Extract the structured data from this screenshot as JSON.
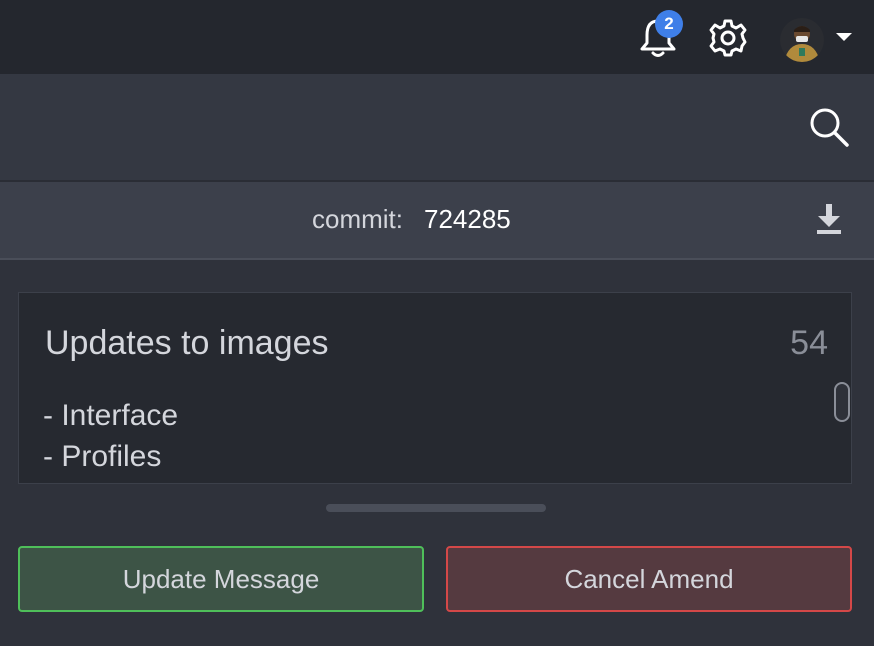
{
  "header": {
    "notifications": {
      "count": "2",
      "icon": "bell-icon"
    },
    "settings": {
      "icon": "gear-icon"
    },
    "profile": {
      "icon": "avatar",
      "menu_icon": "caret-down-icon"
    }
  },
  "search": {
    "icon": "search-icon"
  },
  "commit": {
    "label": "commit:",
    "sha": "724285",
    "download_icon": "download-icon"
  },
  "message": {
    "summary": "Updates to images",
    "summary_remaining_chars": "54",
    "body_lines": [
      "- Interface",
      "- Profiles"
    ]
  },
  "actions": {
    "update_label": "Update Message",
    "cancel_label": "Cancel Amend"
  },
  "colors": {
    "badge": "#3f7fe8",
    "update_border": "#4fbf5a",
    "cancel_border": "#d44848"
  }
}
